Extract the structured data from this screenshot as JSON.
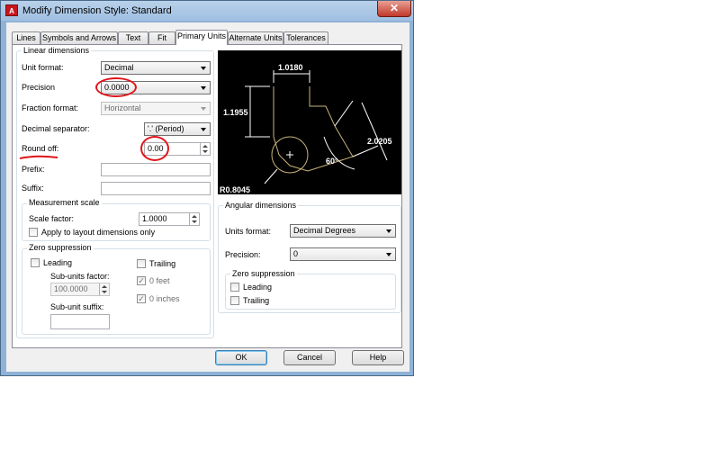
{
  "window": {
    "title": "Modify Dimension Style: Standard",
    "app_icon_text": "A",
    "close_glyph": "✕"
  },
  "tabs": [
    "Lines",
    "Symbols and Arrows",
    "Text",
    "Fit",
    "Primary Units",
    "Alternate Units",
    "Tolerances"
  ],
  "active_tab": "Primary Units",
  "linear": {
    "group_label": "Linear dimensions",
    "unit_format_label": "Unit format:",
    "unit_format_value": "Decimal",
    "precision_label": "Precision",
    "precision_value": "0.0000",
    "fraction_format_label": "Fraction format:",
    "fraction_format_value": "Horizontal",
    "decimal_sep_label": "Decimal separator:",
    "decimal_sep_value": "'.' (Period)",
    "round_off_label": "Round off:",
    "round_off_value": "0.00",
    "prefix_label": "Prefix:",
    "prefix_value": "",
    "suffix_label": "Suffix:",
    "suffix_value": ""
  },
  "measurement_scale": {
    "group_label": "Measurement scale",
    "scale_factor_label": "Scale factor:",
    "scale_factor_value": "1.0000",
    "apply_layout_label": "Apply to layout dimensions only"
  },
  "zero_suppression_linear": {
    "group_label": "Zero suppression",
    "leading_label": "Leading",
    "trailing_label": "Trailing",
    "sub_units_factor_label": "Sub-units factor:",
    "sub_units_factor_value": "100.0000",
    "sub_unit_suffix_label": "Sub-unit suffix:",
    "sub_unit_suffix_value": "",
    "zero_feet_label": "0 feet",
    "zero_inches_label": "0 inches"
  },
  "preview": {
    "dim_top": "1.0180",
    "dim_left": "1.1955",
    "dim_right": "2.0205",
    "dim_angle": "60°",
    "dim_radius": "R0.8045"
  },
  "angular": {
    "group_label": "Angular dimensions",
    "units_format_label": "Units format:",
    "units_format_value": "Decimal Degrees",
    "precision_label": "Precision:",
    "precision_value": "0",
    "zero_group_label": "Zero suppression",
    "leading_label": "Leading",
    "trailing_label": "Trailing"
  },
  "buttons": {
    "ok": "OK",
    "cancel": "Cancel",
    "help": "Help"
  },
  "colors": {
    "annotation_red": "#e0141a",
    "preview_line": "#c9b37a"
  }
}
